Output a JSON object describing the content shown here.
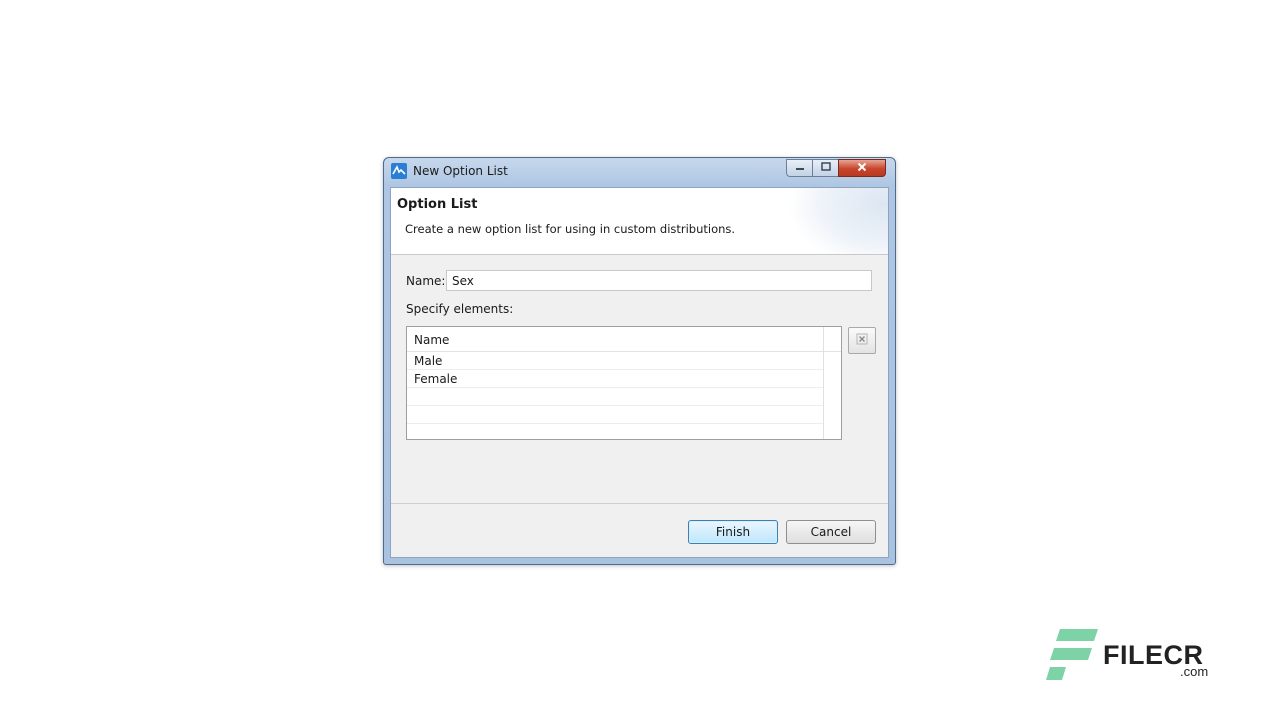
{
  "window": {
    "title": "New Option List",
    "icons": {
      "app": "app-logo-icon",
      "minimize": "minimize-icon",
      "maximize": "maximize-icon",
      "close": "close-icon"
    }
  },
  "banner": {
    "title": "Option List",
    "description": "Create a new option list for using in custom distributions."
  },
  "form": {
    "name_label": "Name:",
    "name_value": "Sex",
    "elements_label": "Specify elements:"
  },
  "table": {
    "column_header": "Name",
    "rows": [
      "Male",
      "Female"
    ]
  },
  "toolbar": {
    "delete_icon": "delete-x-icon"
  },
  "buttons": {
    "finish": "Finish",
    "cancel": "Cancel"
  },
  "watermark": {
    "brand": "FILECR",
    "domain": ".com",
    "colors": {
      "mark": "#7ed3a6",
      "text": "#222222"
    }
  }
}
